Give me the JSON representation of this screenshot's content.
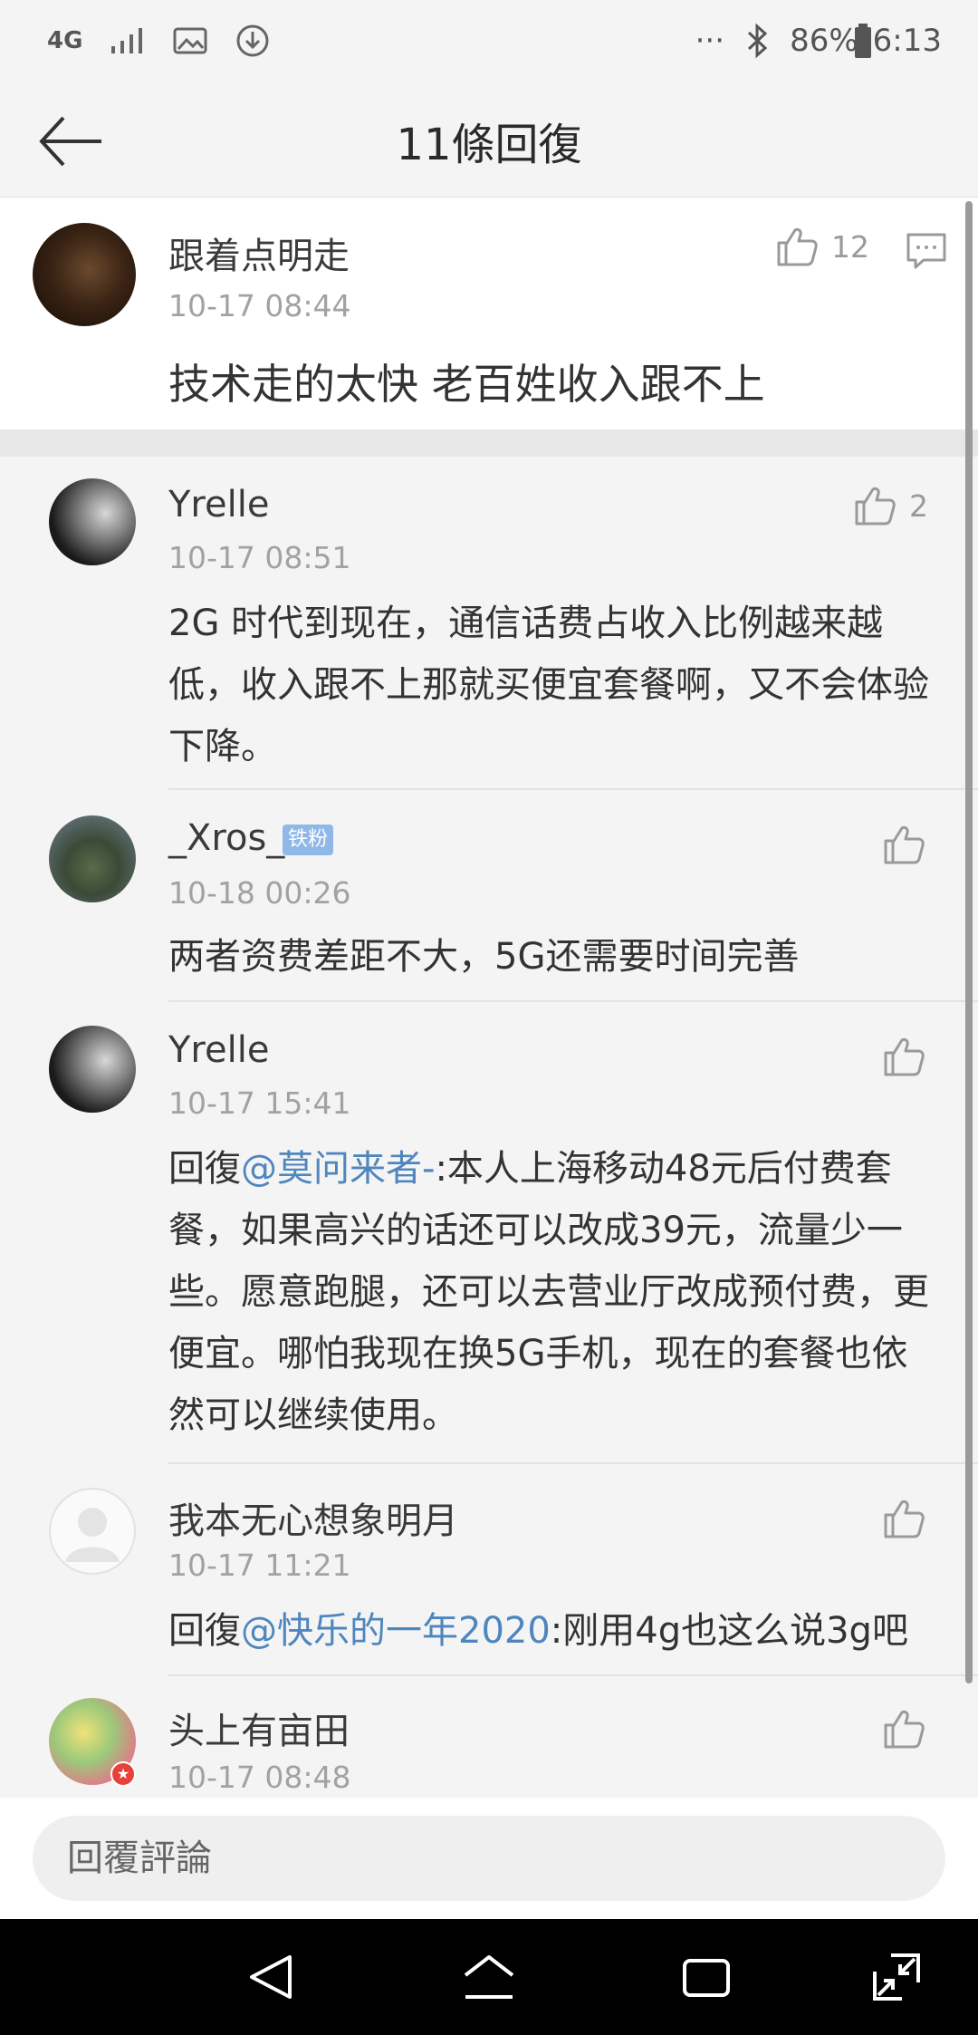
{
  "status_bar": {
    "network_type": "4G",
    "battery": "86%",
    "time": "6:13",
    "more_dots": "···",
    "icons": [
      "4g-icon",
      "signal-icon",
      "image-icon",
      "download-icon",
      "bluetooth-icon",
      "battery-icon"
    ]
  },
  "header": {
    "title": "11條回復",
    "back_icon": "back-arrow-icon"
  },
  "main_comment": {
    "user": "跟着点明走",
    "time": "10-17 08:44",
    "text": "技术走的太快 老百姓收入跟不上",
    "likes": "12",
    "icons": [
      "thumbs-up-icon",
      "comment-icon"
    ]
  },
  "replies": [
    {
      "user": "Yrelle",
      "time": "10-17 08:51",
      "text": "2G 时代到现在，通信话费占收入比例越来越低，收入跟不上那就买便宜套餐啊，又不会体验下降。",
      "likes": "2"
    },
    {
      "user": "_Xros_",
      "badge": "铁粉",
      "time": "10-18 00:26",
      "text": "两者资费差距不大，5G还需要时间完善",
      "likes": ""
    },
    {
      "user": "Yrelle",
      "time": "10-17 15:41",
      "prefix": "回復",
      "mention": "@莫问来者-",
      "text": ":本人上海移动48元后付费套餐，如果高兴的话还可以改成39元，流量少一些。愿意跑腿，还可以去营业厅改成预付费，更便宜。哪怕我现在换5G手机，现在的套餐也依然可以继续使用。",
      "likes": ""
    },
    {
      "user": "我本无心想象明月",
      "time": "10-17 11:21",
      "prefix": "回復",
      "mention": "@快乐的一年2020",
      "text": ":刚用4g也这么说3g吧",
      "likes": ""
    },
    {
      "user": "头上有亩田",
      "time": "10-17 08:48",
      "likes": ""
    }
  ],
  "bottom": {
    "input_placeholder": "回覆評論"
  },
  "nav": {
    "icons": [
      "nav-back-icon",
      "nav-home-icon",
      "nav-recents-icon",
      "nav-expand-icon"
    ]
  },
  "colors": {
    "background": "#f4f4f5",
    "card": "#ffffff",
    "mention": "#4f86bd",
    "badge": "#8fb8e8",
    "muted_text": "#a2a2a2"
  }
}
